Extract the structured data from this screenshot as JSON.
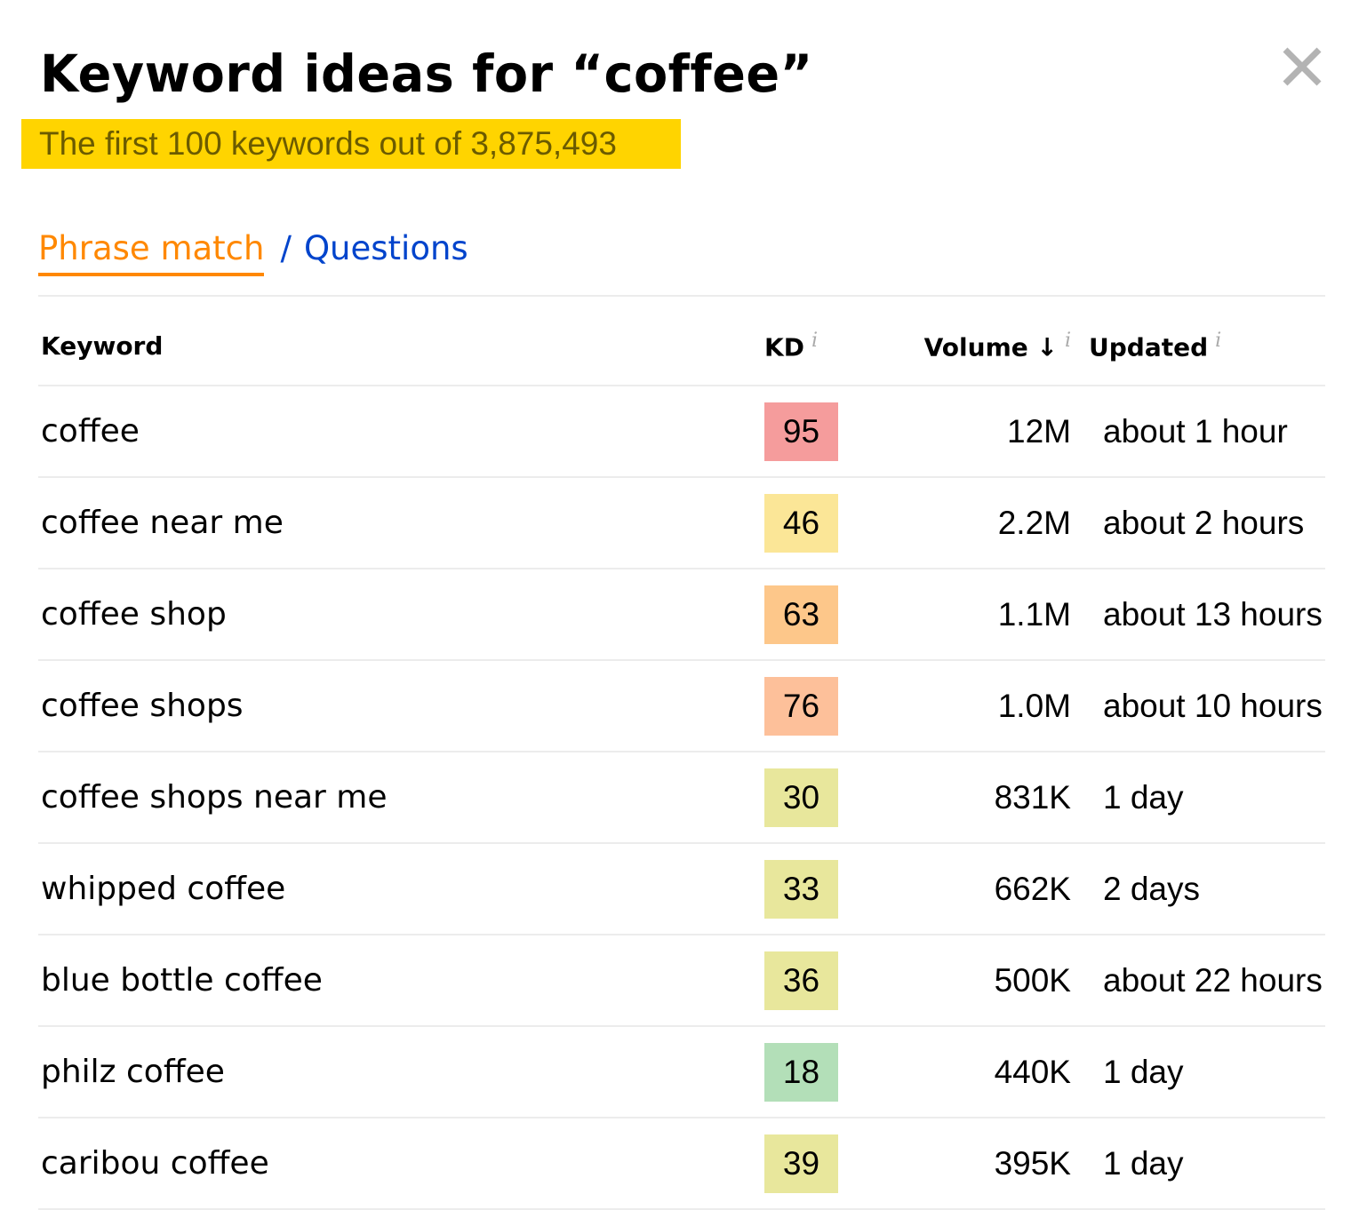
{
  "header": {
    "title": "Keyword ideas for “coffee”",
    "subtitle": "The first 100 keywords out of 3,875,493",
    "close_icon": "close-icon"
  },
  "tabs": {
    "active": "Phrase match",
    "separator": "/",
    "other": "Questions"
  },
  "table": {
    "columns": {
      "keyword": "Keyword",
      "kd": "KD",
      "volume": "Volume",
      "volume_sort": "↓",
      "updated": "Updated",
      "info": "i"
    },
    "rows": [
      {
        "keyword": "coffee",
        "kd": "95",
        "kd_color": "#f59c9c",
        "volume": "12M",
        "updated": "about 1 hour"
      },
      {
        "keyword": "coffee near me",
        "kd": "46",
        "kd_color": "#fbe697",
        "volume": "2.2M",
        "updated": "about 2 hours"
      },
      {
        "keyword": "coffee shop",
        "kd": "63",
        "kd_color": "#fdc78a",
        "volume": "1.1M",
        "updated": "about 13 hours"
      },
      {
        "keyword": "coffee shops",
        "kd": "76",
        "kd_color": "#fdc09a",
        "volume": "1.0M",
        "updated": "about 10 hours"
      },
      {
        "keyword": "coffee shops near me",
        "kd": "30",
        "kd_color": "#e8e79c",
        "volume": "831K",
        "updated": "1 day"
      },
      {
        "keyword": "whipped coffee",
        "kd": "33",
        "kd_color": "#e8e79c",
        "volume": "662K",
        "updated": "2 days"
      },
      {
        "keyword": "blue bottle coffee",
        "kd": "36",
        "kd_color": "#e8e79c",
        "volume": "500K",
        "updated": "about 22 hours"
      },
      {
        "keyword": "philz coffee",
        "kd": "18",
        "kd_color": "#b3dfb8",
        "volume": "440K",
        "updated": "1 day"
      },
      {
        "keyword": "caribou coffee",
        "kd": "39",
        "kd_color": "#e8e79c",
        "volume": "395K",
        "updated": "1 day"
      }
    ]
  }
}
